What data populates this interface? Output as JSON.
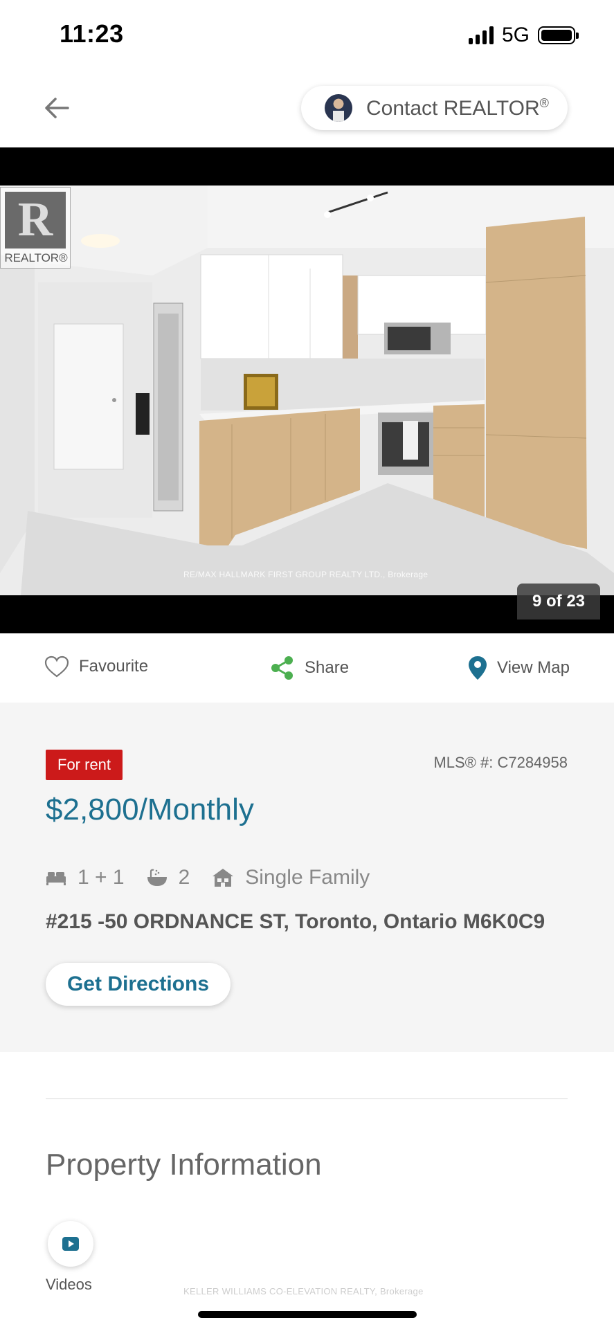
{
  "status_bar": {
    "time": "11:23",
    "network": "5G"
  },
  "header": {
    "contact_label": "Contact REALTOR",
    "contact_mark": "®"
  },
  "photo": {
    "logo_text": "REALTOR",
    "logo_mark": "®",
    "watermark": "RE/MAX HALLMARK FIRST GROUP REALTY LTD., Brokerage",
    "counter": "9 of 23",
    "current": 9,
    "total": 23
  },
  "actions": {
    "favourite": "Favourite",
    "share": "Share",
    "view_map": "View Map"
  },
  "listing": {
    "status_badge": "For rent",
    "mls": "MLS® #: C7284958",
    "price": "$2,800/Monthly",
    "bedrooms": "1 + 1",
    "bathrooms": "2",
    "property_type": "Single Family",
    "address": "#215 -50 ORDNANCE ST, Toronto, Ontario M6K0C9",
    "directions_label": "Get Directions"
  },
  "property_info": {
    "title": "Property Information",
    "videos_label": "Videos",
    "footer_watermark": "KELLER WILLIAMS CO-ELEVATION REALTY, Brokerage"
  },
  "colors": {
    "accent": "#1d7090",
    "badge": "#cc1a1a",
    "share_icon": "#4caf50",
    "map_pin": "#1d7090"
  }
}
